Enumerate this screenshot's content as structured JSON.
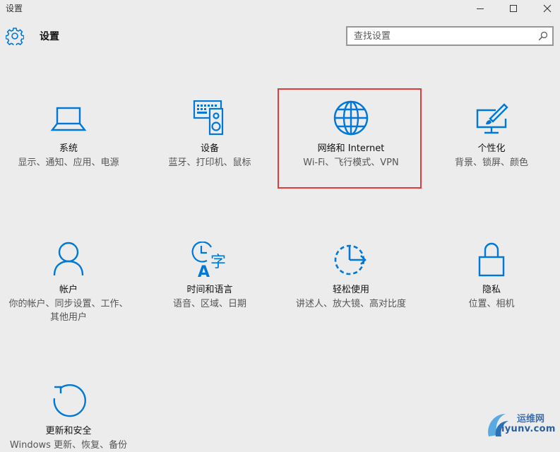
{
  "window": {
    "title": "设置"
  },
  "header": {
    "title": "设置"
  },
  "search": {
    "placeholder": "查找设置"
  },
  "accent_color": "#0078d7",
  "highlight_color": "#e23b3b",
  "tiles": [
    {
      "name": "系统",
      "desc": "显示、通知、应用、电源",
      "icon": "laptop-icon"
    },
    {
      "name": "设备",
      "desc": "蓝牙、打印机、鼠标",
      "icon": "keyboard-speaker-icon"
    },
    {
      "name": "网络和 Internet",
      "desc": "Wi-Fi、飞行模式、VPN",
      "icon": "globe-icon"
    },
    {
      "name": "个性化",
      "desc": "背景、锁屏、颜色",
      "icon": "paintbrush-monitor-icon"
    },
    {
      "name": "帐户",
      "desc": "你的帐户、同步设置、工作、其他用户",
      "icon": "person-icon"
    },
    {
      "name": "时间和语言",
      "desc": "语音、区域、日期",
      "icon": "clock-language-icon"
    },
    {
      "name": "轻松使用",
      "desc": "讲述人、放大镜、高对比度",
      "icon": "ease-of-access-icon"
    },
    {
      "name": "隐私",
      "desc": "位置、相机",
      "icon": "lock-icon"
    },
    {
      "name": "更新和安全",
      "desc": "Windows 更新、恢复、备份",
      "icon": "refresh-icon"
    }
  ],
  "watermark": {
    "line1": "运维网",
    "line2": "iyunv.com"
  }
}
